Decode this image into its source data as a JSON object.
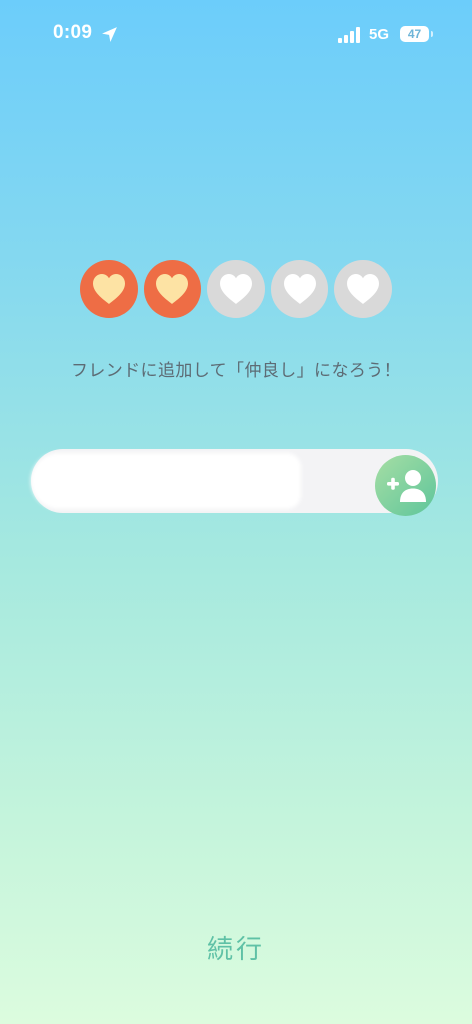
{
  "status_bar": {
    "time": "0:09",
    "network": "5G",
    "battery_level": "47",
    "battery_fraction": 0.47
  },
  "hearts": {
    "filled": 2,
    "total": 5,
    "filled_color": "#ee6d45",
    "filled_heart_color": "#fde3a4",
    "empty_color": "#d9d9d9"
  },
  "message": "フレンドに追加して「仲良し」になろう！",
  "friend_input": {
    "value": "",
    "placeholder": ""
  },
  "continue_label": "続行",
  "colors": {
    "accent": "#5fc1a6"
  }
}
